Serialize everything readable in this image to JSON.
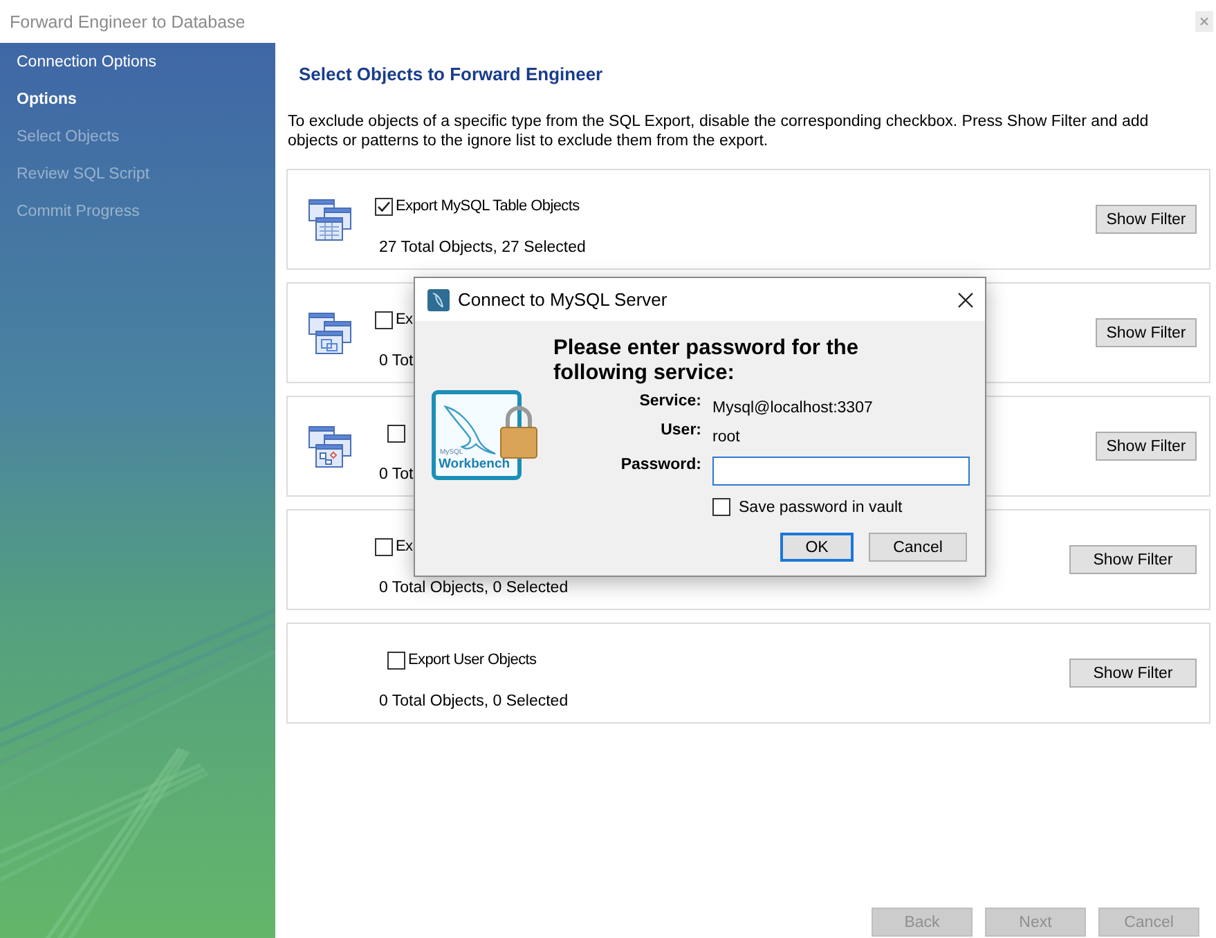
{
  "window": {
    "title": "Forward Engineer to Database"
  },
  "sidebar": {
    "items": [
      {
        "label": "Connection Options",
        "selected": false,
        "disabled": false
      },
      {
        "label": "Options",
        "selected": true,
        "disabled": false
      },
      {
        "label": "Select Objects",
        "selected": false,
        "disabled": true
      },
      {
        "label": "Review SQL Script",
        "selected": false,
        "disabled": true
      },
      {
        "label": "Commit Progress",
        "selected": false,
        "disabled": true
      }
    ]
  },
  "page": {
    "heading": "Select Objects to Forward Engineer",
    "description": "To exclude objects of a specific type from the SQL Export, disable the corresponding checkbox. Press Show Filter and add objects or patterns to the ignore list to exclude them from the export."
  },
  "objects": [
    {
      "kind": "table",
      "label": "Export MySQL Table Objects",
      "checked": true,
      "summary": "27 Total Objects, 27 Selected",
      "button": "Show Filter"
    },
    {
      "kind": "view",
      "label": "Ex",
      "checked": false,
      "summary": "0 Tot",
      "button": "Show Filter"
    },
    {
      "kind": "routine",
      "checked": false,
      "summary": "0 Tot",
      "button": "Show Filter"
    },
    {
      "kind": "trigger",
      "label": "Ex",
      "checked": false,
      "summary": "0 Total Objects, 0 Selected",
      "button": "Show Filter"
    },
    {
      "kind": "user",
      "label": "Export User Objects",
      "checked": false,
      "summary": "0 Total Objects, 0 Selected",
      "button": "Show Filter"
    }
  ],
  "buttons": [
    {
      "label": "Back",
      "disabled": true
    },
    {
      "label": "Next",
      "disabled": true
    },
    {
      "label": "Cancel",
      "disabled": true
    }
  ],
  "dialog": {
    "title": "Connect to MySQL Server",
    "logo": {
      "brand": "MySQL",
      "product": "Workbench"
    },
    "heading": "Please enter password for the following service:",
    "fields": [
      {
        "kind": "text",
        "label": "Service:",
        "value": "Mysql@localhost:3307"
      },
      {
        "kind": "text",
        "label": "User:",
        "value": "root"
      },
      {
        "kind": "input",
        "label": "Password:"
      }
    ],
    "save_password": {
      "label": "Save password in vault",
      "checked": false
    },
    "buttons": [
      {
        "label": "OK",
        "default": true
      },
      {
        "label": "Cancel",
        "default": false
      }
    ]
  }
}
